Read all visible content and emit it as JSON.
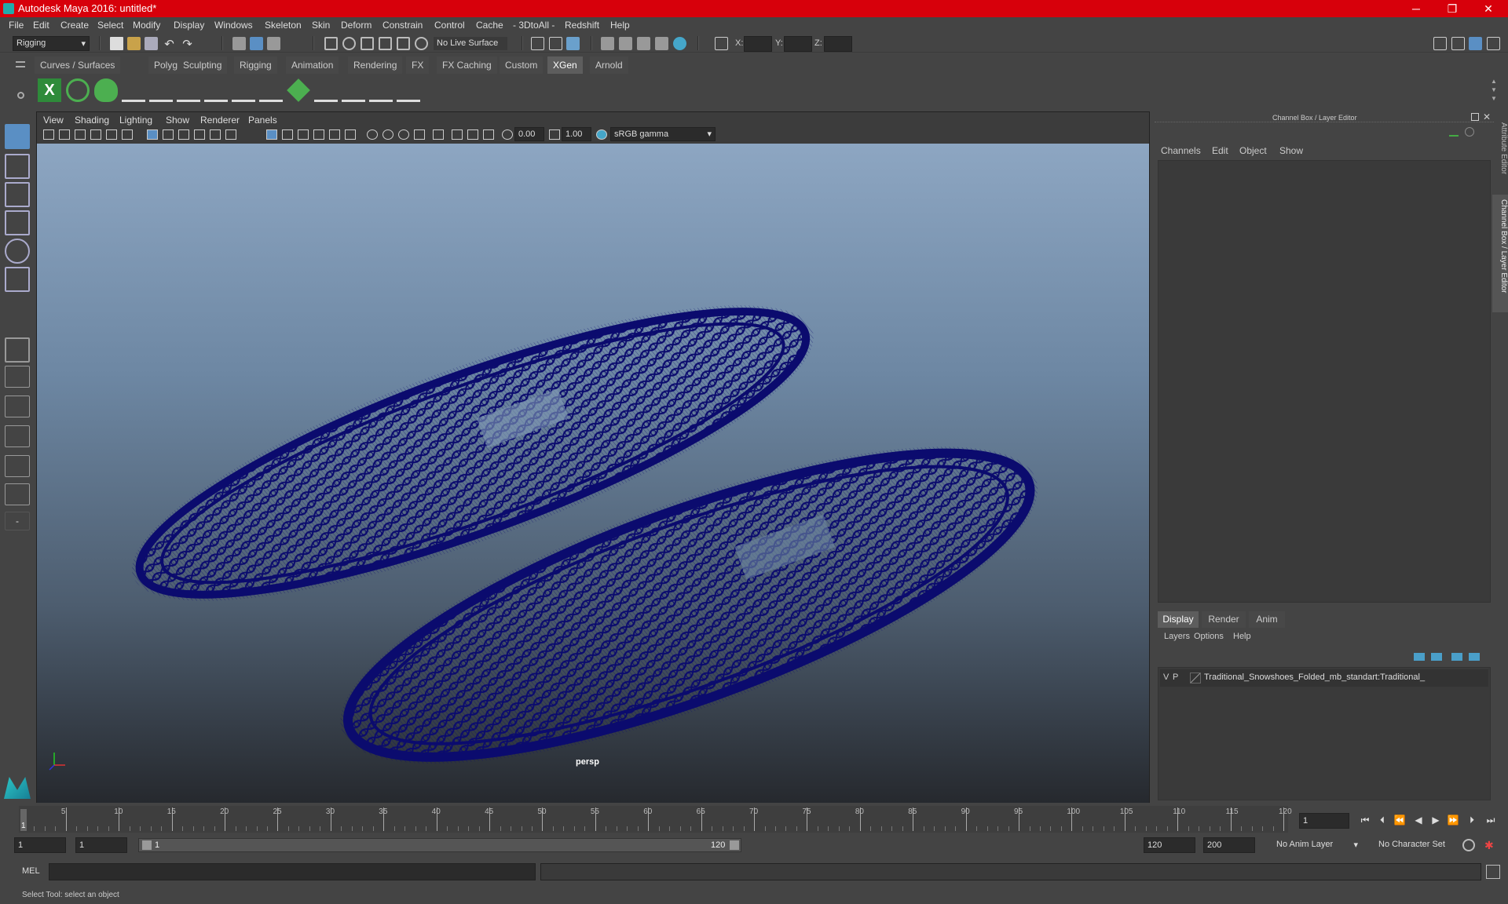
{
  "title_bar": {
    "title": "Autodesk Maya 2016: untitled*",
    "minimize": "─",
    "maximize": "❐",
    "close": "✕"
  },
  "menus": [
    "File",
    "Edit",
    "Create",
    "Select",
    "Modify",
    "Display",
    "Windows",
    "Skeleton",
    "Skin",
    "Deform",
    "Constrain",
    "Control",
    "Cache",
    "- 3DtoAll -",
    "Redshift",
    "Help"
  ],
  "status_line": {
    "menu_set": "Rigging",
    "live_surface": "No Live Surface",
    "x_label": "X:",
    "y_label": "Y:",
    "z_label": "Z:"
  },
  "shelf_tabs": [
    {
      "label": "Curves / Surfaces",
      "active": false
    },
    {
      "label": "Polygons",
      "active": false
    },
    {
      "label": "Sculpting",
      "active": false
    },
    {
      "label": "Rigging",
      "active": false
    },
    {
      "label": "Animation",
      "active": false
    },
    {
      "label": "Rendering",
      "active": false
    },
    {
      "label": "FX",
      "active": false
    },
    {
      "label": "FX Caching",
      "active": false
    },
    {
      "label": "Custom",
      "active": false
    },
    {
      "label": "XGen",
      "active": true
    },
    {
      "label": "Arnold",
      "active": false
    }
  ],
  "viewport": {
    "menus": [
      "View",
      "Shading",
      "Lighting",
      "Show",
      "Renderer",
      "Panels"
    ],
    "exposure": "0.00",
    "gamma": "1.00",
    "color_space": "sRGB gamma",
    "camera_label": "persp",
    "wire_color": "#0b0b6e"
  },
  "channel_box": {
    "title": "Channel Box / Layer Editor",
    "menus": [
      "Channels",
      "Edit",
      "Object",
      "Show"
    ],
    "tabs": [
      {
        "label": "Display",
        "active": true
      },
      {
        "label": "Render",
        "active": false
      },
      {
        "label": "Anim",
        "active": false
      }
    ],
    "layer_menus": [
      "Layers",
      "Options",
      "Help"
    ],
    "layers": [
      {
        "v": "V",
        "p": "P",
        "name": "Traditional_Snowshoes_Folded_mb_standart:Traditional_"
      }
    ]
  },
  "side_tabs": [
    "Attribute Editor",
    "Channel Box / Layer Editor"
  ],
  "timeline": {
    "ticks": [
      5,
      10,
      15,
      20,
      25,
      30,
      35,
      40,
      45,
      50,
      55,
      60,
      65,
      70,
      75,
      80,
      85,
      90,
      95,
      100,
      105,
      110,
      115,
      120
    ],
    "start": 1,
    "end": 120,
    "current_frame": "1",
    "playhead_label": "1"
  },
  "range": {
    "start": "1",
    "range_start": "1",
    "slider_start": "1",
    "slider_end": "120",
    "range_end": "120",
    "end": "200",
    "anim_layer": "No Anim Layer",
    "character_set": "No Character Set"
  },
  "command_line": {
    "language": "MEL"
  },
  "help_line": {
    "text": "Select Tool: select an object"
  }
}
